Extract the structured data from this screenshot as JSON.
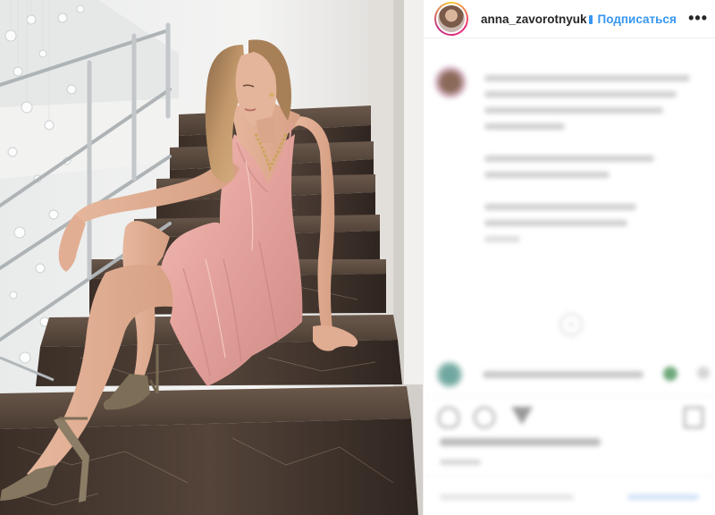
{
  "post": {
    "username": "anna_zavorotnyuk",
    "verified": true,
    "follow_label": "Подписаться",
    "more_label": "•••"
  },
  "photo": {
    "subject": "woman in pink satin slip dress seated on marble staircase",
    "palette": {
      "dress": "#e8a9a4",
      "skin": "#e8b9a0",
      "hair": "#b98d5f",
      "marble": "#4a3b31",
      "wall": "#eeeeec",
      "railing": "#b8bcbf"
    }
  },
  "icons": [
    "verified-badge-icon",
    "more-options-icon",
    "heart-icon",
    "comment-icon",
    "share-icon",
    "save-icon",
    "loader-icon"
  ],
  "colors": {
    "accent": "#3897f0",
    "text": "#262626",
    "muted": "#8e8e8e",
    "border": "#efefef"
  }
}
